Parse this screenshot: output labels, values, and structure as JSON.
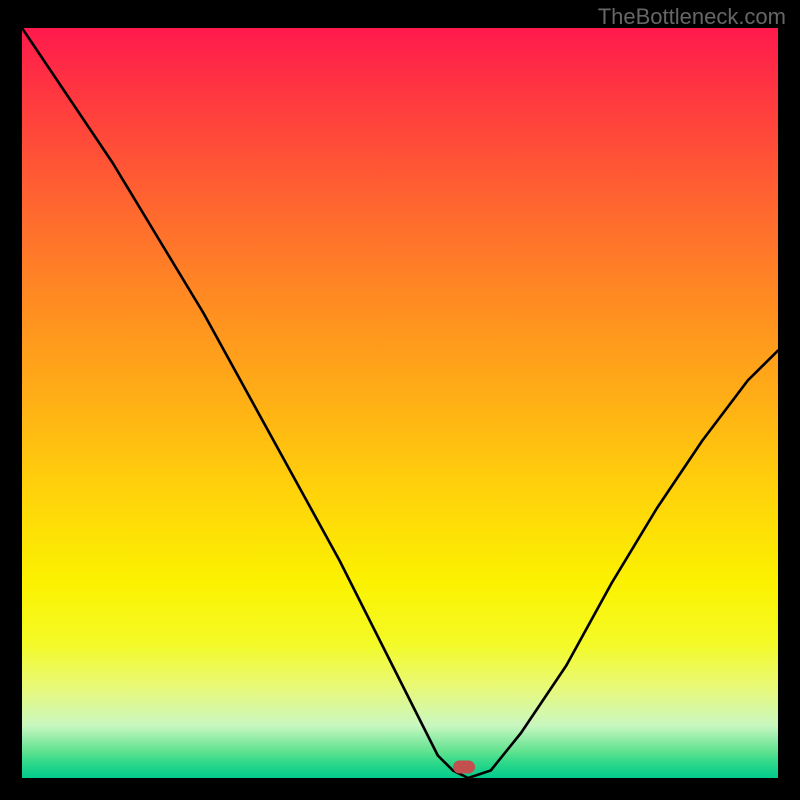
{
  "watermark": "TheBottleneck.com",
  "chart_data": {
    "type": "line",
    "title": "",
    "xlabel": "",
    "ylabel": "",
    "xlim": [
      0,
      100
    ],
    "ylim": [
      0,
      100
    ],
    "series": [
      {
        "name": "bottleneck-curve",
        "x": [
          0,
          6,
          12,
          18,
          24,
          30,
          36,
          42,
          48,
          52,
          55,
          57,
          59,
          62,
          66,
          72,
          78,
          84,
          90,
          96,
          100
        ],
        "values": [
          100,
          91,
          82,
          72,
          62,
          51,
          40,
          29,
          17,
          9,
          3,
          1,
          0,
          1,
          6,
          15,
          26,
          36,
          45,
          53,
          57
        ]
      }
    ],
    "annotations": [
      {
        "name": "optimal-marker",
        "type": "point",
        "x": 58.5,
        "y": 1.5,
        "color": "#c1504e"
      }
    ],
    "background_gradient": {
      "top": "#ff1a4d",
      "bottom": "#00cb8c",
      "description": "vertical red-yellow-green gradient indicating bottleneck severity"
    }
  }
}
